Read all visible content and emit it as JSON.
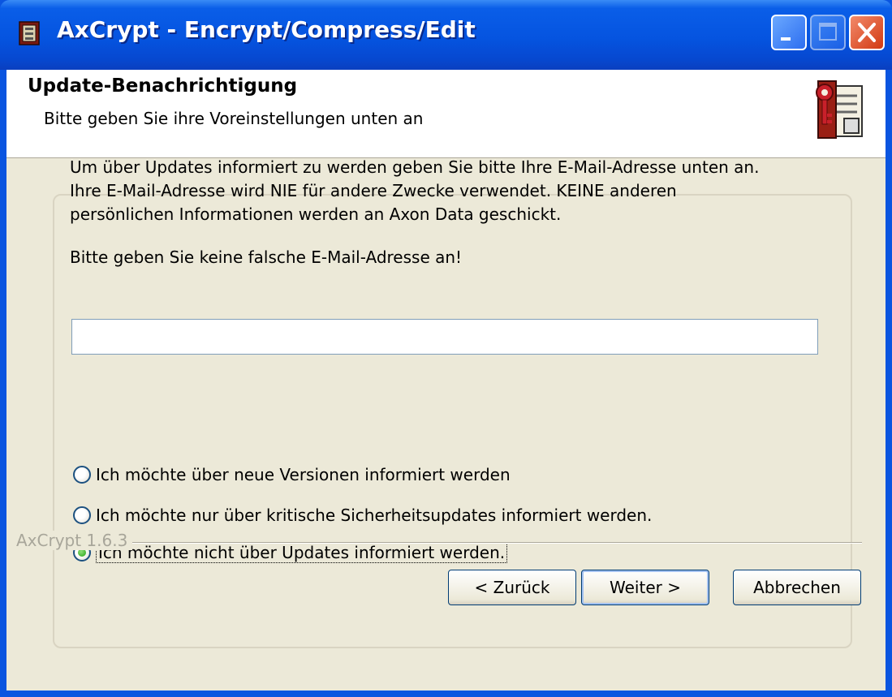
{
  "window": {
    "title": "AxCrypt - Encrypt/Compress/Edit"
  },
  "header": {
    "title": "Update-Benachrichtigung",
    "subtitle": "Bitte geben Sie ihre Voreinstellungen unten an"
  },
  "main": {
    "description": "Um über Updates informiert zu werden geben Sie bitte Ihre E-Mail-Adresse unten an.\nIhre E-Mail-Adresse wird NIE für andere Zwecke verwendet. KEINE anderen\npersönlichen Informationen werden an Axon Data geschickt.",
    "warning": "Bitte geben Sie keine falsche E-Mail-Adresse an!",
    "email_value": "",
    "options": [
      {
        "label": "Ich möchte über neue Versionen informiert werden",
        "selected": false
      },
      {
        "label": "Ich möchte nur über kritische Sicherheitsupdates informiert werden.",
        "selected": false
      },
      {
        "label": "Ich möchte nicht über Updates informiert werden.",
        "selected": true
      }
    ]
  },
  "footer": {
    "version": "AxCrypt 1.6.3",
    "back_label": "< Zurück",
    "next_label": "Weiter >",
    "cancel_label": "Abbrechen"
  },
  "icons": {
    "app": "safe-icon",
    "header": "key-document-icon",
    "minimize": "minimize-icon",
    "maximize": "maximize-icon",
    "close": "close-icon"
  }
}
